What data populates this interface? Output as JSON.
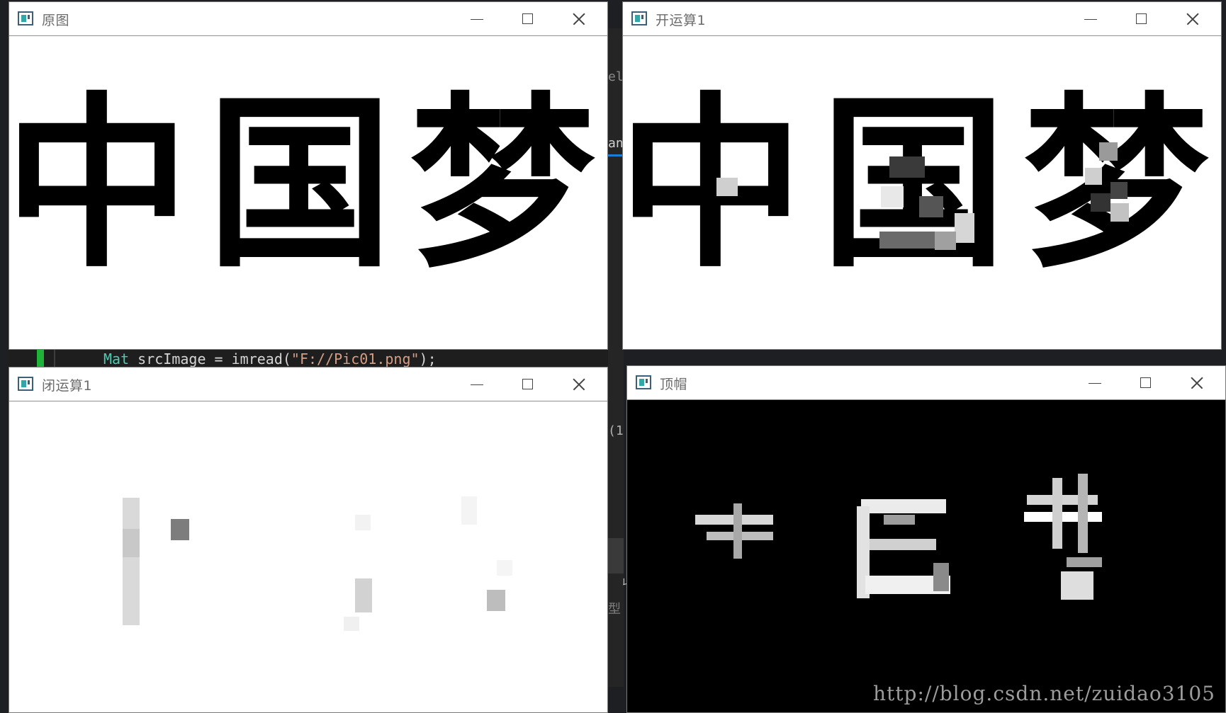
{
  "ide": {
    "code_line_parts": [
      "Mat",
      " srcImage = imread(",
      "\"F://Pic01.png\"",
      ");"
    ],
    "fragment_ele": "ele",
    "fragment_an": "an",
    "fragment_paren": "(1",
    "fragment_xing": "型",
    "fragment_ha": "ㄐ"
  },
  "windows": {
    "original": {
      "title": "原图"
    },
    "opening": {
      "title": "开运算1"
    },
    "closing": {
      "title": "闭运算1"
    },
    "tophat": {
      "title": "顶帽"
    }
  },
  "image_text": "中国梦",
  "watermark": "http://blog.csdn.net/zuidao3105",
  "colors": {
    "ide_bg": "#1e1f22",
    "code_type": "#4ec9b0",
    "code_string": "#d69d85",
    "gutter_green": "#1fb33a",
    "accent_blue": "#1c7ed6"
  }
}
